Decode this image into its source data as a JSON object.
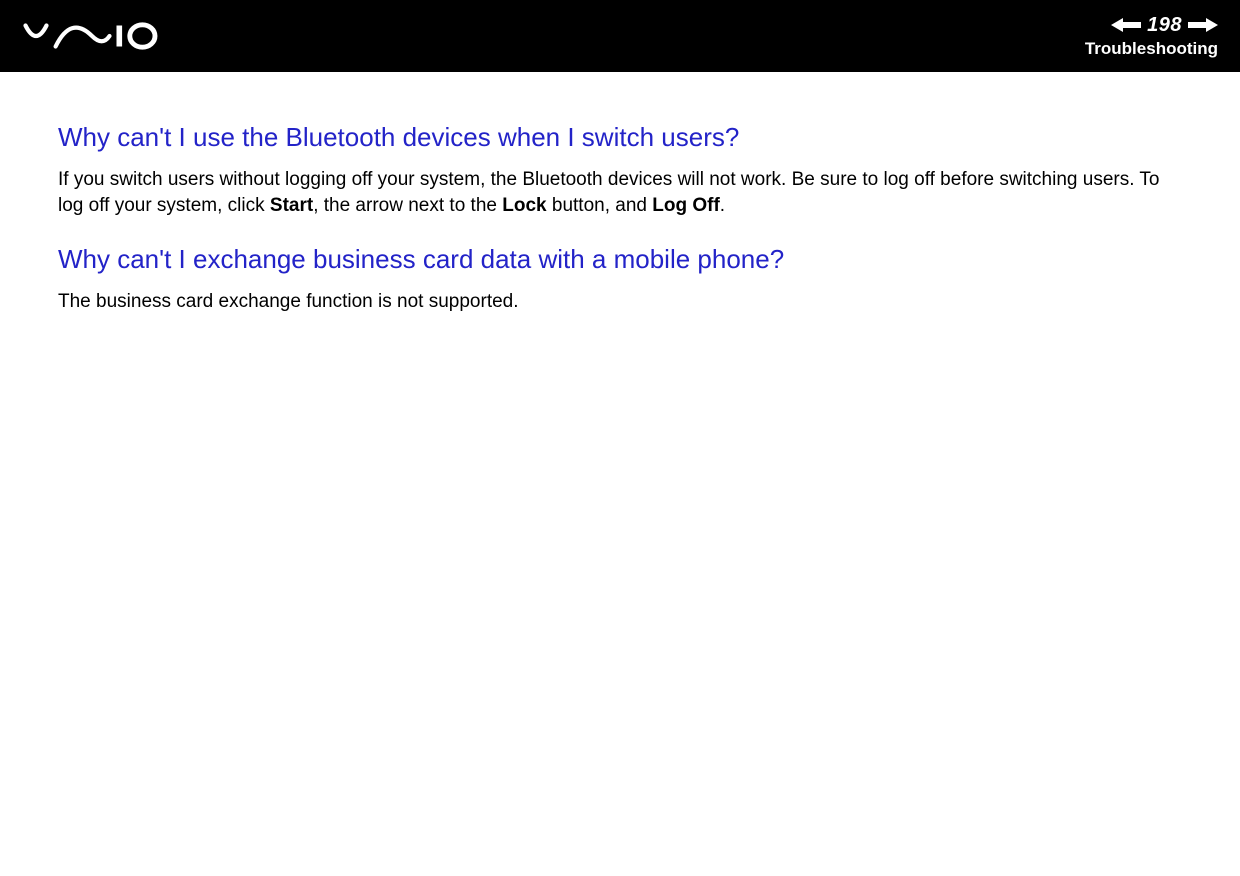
{
  "header": {
    "page_number": "198",
    "section_title": "Troubleshooting"
  },
  "content": {
    "qa": [
      {
        "question": "Why can't I use the Bluetooth devices when I switch users?",
        "answer_parts": [
          {
            "text": "If you switch users without logging off your system, the Bluetooth devices will not work. Be sure to log off before switching users. To log off your system, click ",
            "bold": false
          },
          {
            "text": "Start",
            "bold": true
          },
          {
            "text": ", the arrow next to the ",
            "bold": false
          },
          {
            "text": "Lock",
            "bold": true
          },
          {
            "text": " button, and ",
            "bold": false
          },
          {
            "text": "Log Off",
            "bold": true
          },
          {
            "text": ".",
            "bold": false
          }
        ]
      },
      {
        "question": "Why can't I exchange business card data with a mobile phone?",
        "answer_parts": [
          {
            "text": "The business card exchange function is not supported.",
            "bold": false
          }
        ]
      }
    ]
  }
}
